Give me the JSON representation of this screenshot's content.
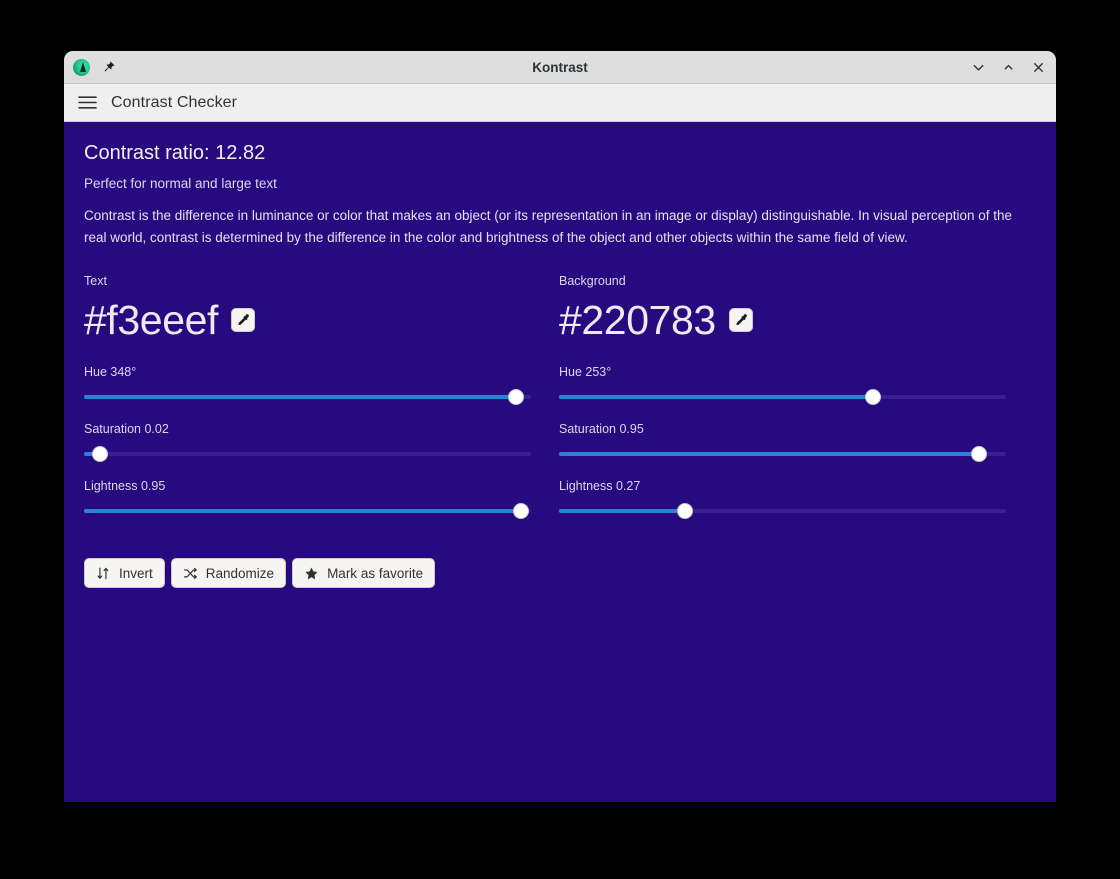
{
  "window": {
    "title": "Kontrast",
    "logo_icon": "kontrast-logo-icon",
    "pin_icon": "pin-icon",
    "controls": [
      {
        "name": "minimize-button",
        "icon": "chevron-down-icon"
      },
      {
        "name": "maximize-button",
        "icon": "chevron-up-icon"
      },
      {
        "name": "close-button",
        "icon": "close-icon"
      }
    ]
  },
  "headerbar": {
    "menu_icon": "hamburger-menu-icon",
    "title": "Contrast Checker"
  },
  "main": {
    "ratio_title": "Contrast ratio: 12.82",
    "ratio_value": "12.82",
    "rating": "Perfect for normal and large text",
    "description": "Contrast is the difference in luminance or color that makes an object (or its representation in an image or display) distinguishable. In visual perception of the real world, contrast is determined by the difference in the color and brightness of the object and other objects within the same field of view."
  },
  "colors": {
    "page_background": "#280a80",
    "text_color": "#f3eeef",
    "background_color": "#220783",
    "slider_fill": "#2d82d6",
    "slider_track": "#3b1f92"
  },
  "text_panel": {
    "label": "Text",
    "hex": "#f3eeef",
    "picker_icon": "eyedropper-icon",
    "sliders": [
      {
        "label": "Hue 348°",
        "name": "hue",
        "value": 348,
        "max": 360,
        "percent": 96.7
      },
      {
        "label": "Saturation 0.02",
        "name": "saturation",
        "value": 0.02,
        "max": 1,
        "percent": 3.6
      },
      {
        "label": "Lightness 0.95",
        "name": "lightness",
        "value": 0.95,
        "max": 1,
        "percent": 97.8
      }
    ]
  },
  "background_panel": {
    "label": "Background",
    "hex": "#220783",
    "picker_icon": "eyedropper-icon",
    "sliders": [
      {
        "label": "Hue 253°",
        "name": "hue",
        "value": 253,
        "max": 360,
        "percent": 70.2
      },
      {
        "label": "Saturation 0.95",
        "name": "saturation",
        "value": 0.95,
        "max": 1,
        "percent": 94.0
      },
      {
        "label": "Lightness 0.27",
        "name": "lightness",
        "value": 0.27,
        "max": 1,
        "percent": 28.2
      }
    ]
  },
  "actions": [
    {
      "label": "Invert",
      "name": "invert-button",
      "icon": "invert-arrows-icon"
    },
    {
      "label": "Randomize",
      "name": "randomize-button",
      "icon": "shuffle-icon"
    },
    {
      "label": "Mark as favorite",
      "name": "favorite-button",
      "icon": "star-icon"
    }
  ]
}
